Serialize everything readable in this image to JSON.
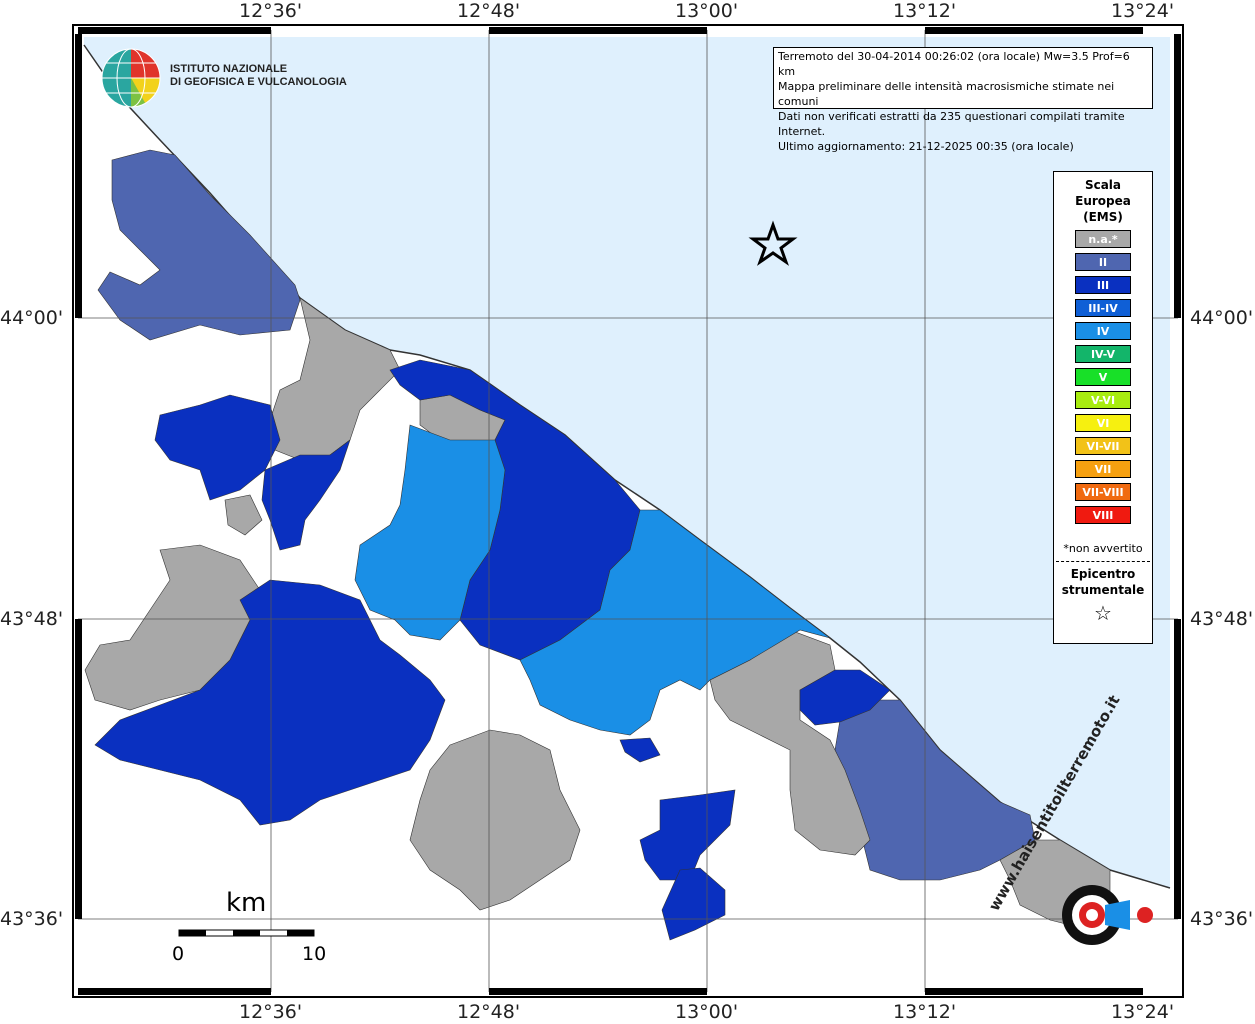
{
  "header": {
    "lines": [
      "Terremoto del 30-04-2014 00:26:02 (ora locale) Mw=3.5 Prof=6 km",
      "Mappa preliminare delle intensità macrosismiche stimate nei comuni",
      "Dati non verificati estratti da 235 questionari compilati tramite Internet.",
      "Ultimo aggiornamento: 21-12-2025 00:35 (ora locale)"
    ]
  },
  "logo": {
    "line1": "ISTITUTO NAZIONALE",
    "line2": "DI GEOFISICA E VULCANOLOGIA",
    "icon": "ingv-globe-icon"
  },
  "axes": {
    "top_lon": [
      "12°36'",
      "12°48'",
      "13°00'",
      "13°12'",
      "13°24'"
    ],
    "bottom_lon": [
      "12°36'",
      "12°48'",
      "13°00'",
      "13°12'",
      "13°24'"
    ],
    "left_lat": [
      "44°00'",
      "43°48'",
      "43°36'"
    ],
    "right_lat": [
      "44°00'",
      "43°48'",
      "43°36'"
    ]
  },
  "legend": {
    "title_lines": [
      "Scala",
      "Europea",
      "(EMS)"
    ],
    "items": [
      {
        "label": "n.a.*",
        "color": "#a8a8a8"
      },
      {
        "label": "II",
        "color": "#4f66b0"
      },
      {
        "label": "III",
        "color": "#0a30c0"
      },
      {
        "label": "III-IV",
        "color": "#0f5fd6"
      },
      {
        "label": "IV",
        "color": "#1a8fe6"
      },
      {
        "label": "IV-V",
        "color": "#13b56a"
      },
      {
        "label": "V",
        "color": "#18e028"
      },
      {
        "label": "V-VI",
        "color": "#a8ec10"
      },
      {
        "label": "VI",
        "color": "#f6f010"
      },
      {
        "label": "VI-VII",
        "color": "#f2c218"
      },
      {
        "label": "VII",
        "color": "#f6a010"
      },
      {
        "label": "VII-VIII",
        "color": "#f06a10"
      },
      {
        "label": "VIII",
        "color": "#f01a10"
      }
    ],
    "note": "*non avvertito",
    "epicenter_lines": [
      "Epicentro",
      "strumentale"
    ],
    "epicenter_icon": "star-icon"
  },
  "scale": {
    "unit": "km",
    "min_label": "0",
    "max_label": "10"
  },
  "watermark": {
    "text": "www.haisentitoilterremoto.it",
    "icon": "megaphone-icon"
  },
  "colors": {
    "sea": "#dff0fd",
    "land": "#ffffff",
    "grid": "#555555",
    "na": "#a8a8a8",
    "II": "#4f66b0",
    "III": "#0a30c0",
    "IV": "#1a8fe6"
  }
}
